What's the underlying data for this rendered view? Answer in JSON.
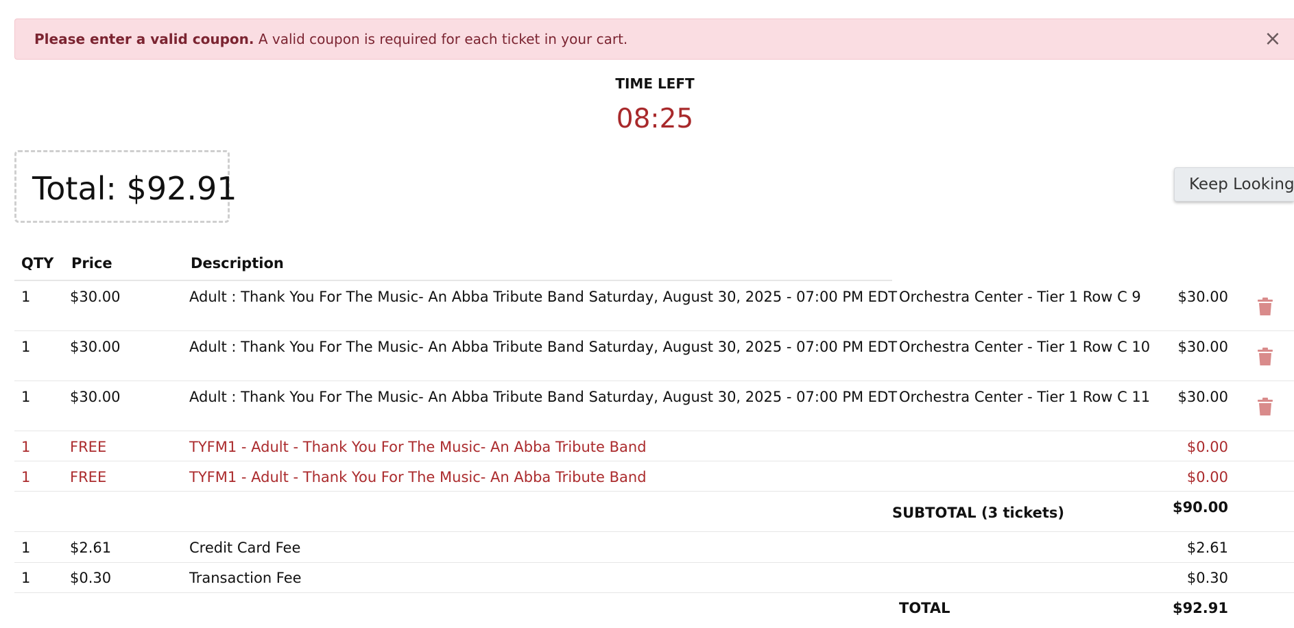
{
  "alert": {
    "bold": "Please enter a valid coupon.",
    "message": " A valid coupon is required for each ticket in your cart.",
    "close": "×"
  },
  "timer": {
    "label": "TIME LEFT",
    "value": "08:25"
  },
  "total_box": {
    "text": "Total: $92.91"
  },
  "keep_looking": "Keep Looking",
  "table": {
    "headers": {
      "qty": "QTY",
      "price": "Price",
      "description": "Description"
    },
    "tickets": [
      {
        "qty": "1",
        "price": "$30.00",
        "description": "Adult : Thank You For The Music- An Abba Tribute Band Saturday, August 30, 2025 - 07:00 PM EDT",
        "location": "Orchestra Center - Tier 1 Row C 9",
        "amount": "$30.00"
      },
      {
        "qty": "1",
        "price": "$30.00",
        "description": "Adult : Thank You For The Music- An Abba Tribute Band Saturday, August 30, 2025 - 07:00 PM EDT",
        "location": "Orchestra Center - Tier 1 Row C 10",
        "amount": "$30.00"
      },
      {
        "qty": "1",
        "price": "$30.00",
        "description": "Adult : Thank You For The Music- An Abba Tribute Band Saturday, August 30, 2025 - 07:00 PM EDT",
        "location": "Orchestra Center - Tier 1 Row C 11",
        "amount": "$30.00"
      }
    ],
    "free_items": [
      {
        "qty": "1",
        "price": "FREE",
        "description": "TYFM1 - Adult - Thank You For The Music- An Abba Tribute Band",
        "amount": "$0.00"
      },
      {
        "qty": "1",
        "price": "FREE",
        "description": "TYFM1 - Adult - Thank You For The Music- An Abba Tribute Band",
        "amount": "$0.00"
      }
    ],
    "subtotal": {
      "label": "SUBTOTAL (3 tickets)",
      "amount": "$90.00"
    },
    "fees": [
      {
        "qty": "1",
        "price": "$2.61",
        "description": "Credit Card Fee",
        "amount": "$2.61"
      },
      {
        "qty": "1",
        "price": "$0.30",
        "description": "Transaction Fee",
        "amount": "$0.30"
      }
    ],
    "total": {
      "label": "TOTAL",
      "amount": "$92.91"
    }
  },
  "colors": {
    "alert_bg": "#fadde2",
    "alert_text": "#7b2431",
    "timer": "#a8292b",
    "free_text": "#ab2b2d",
    "trash": "#d98b8b"
  },
  "icons": {
    "close": "close-icon",
    "delete": "trash-icon"
  }
}
